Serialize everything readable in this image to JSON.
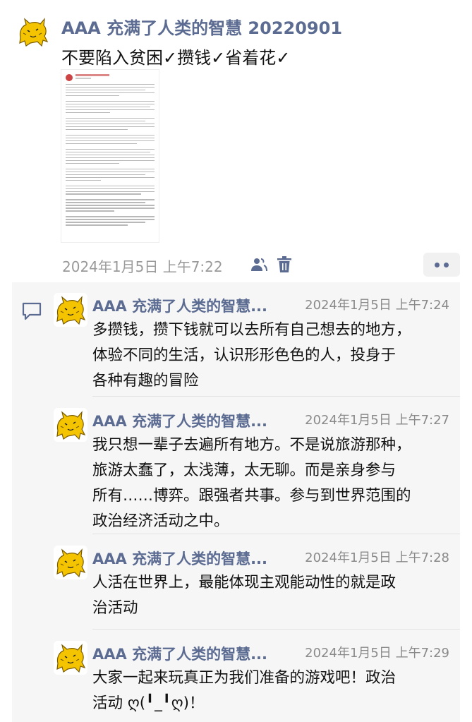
{
  "post": {
    "author": "AAA 充满了人类的智慧 20220901",
    "text": "不要陷入贫困✓攒钱✓省着花✓",
    "time": "2024年1月5日 上午7:22",
    "attachment_icon": "document-thumbnail"
  },
  "actions": {
    "visibility_icon": "people-icon",
    "delete_icon": "trash-icon",
    "more_icon": "more-dots-icon"
  },
  "comments": [
    {
      "author": "AAA 充满了人类的智慧...",
      "time": "2024年1月5日 上午7:24",
      "lines": [
        "多攒钱，攒下钱就可以去所有自己想去的地方，",
        "体验不同的生活，认识形形色色的人，投身于",
        "各种有趣的冒险"
      ]
    },
    {
      "author": "AAA 充满了人类的智慧...",
      "time": "2024年1月5日 上午7:27",
      "lines": [
        "我只想一辈子去遍所有地方。不是说旅游那种，",
        "旅游太蠢了，太浅薄，太无聊。而是亲身参与",
        "所有……博弈。跟强者共事。参与到世界范围的",
        "政治经济活动之中。"
      ]
    },
    {
      "author": "AAA 充满了人类的智慧...",
      "time": "2024年1月5日 上午7:28",
      "lines": [
        "人活在世界上，最能体现主观能动性的就是政",
        "治活动"
      ]
    },
    {
      "author": "AAA 充满了人类的智慧...",
      "time": "2024年1月5日 上午7:29",
      "lines": [
        "大家一起来玩真正为我们准备的游戏吧！政治",
        "活动 ღ(╹_╹ღ)！"
      ]
    }
  ],
  "colors": {
    "accent": "#5b6b91",
    "time": "#9a9a9a",
    "comment_bg": "#f6f6f6",
    "avatar_yellow": "#f5c400"
  }
}
